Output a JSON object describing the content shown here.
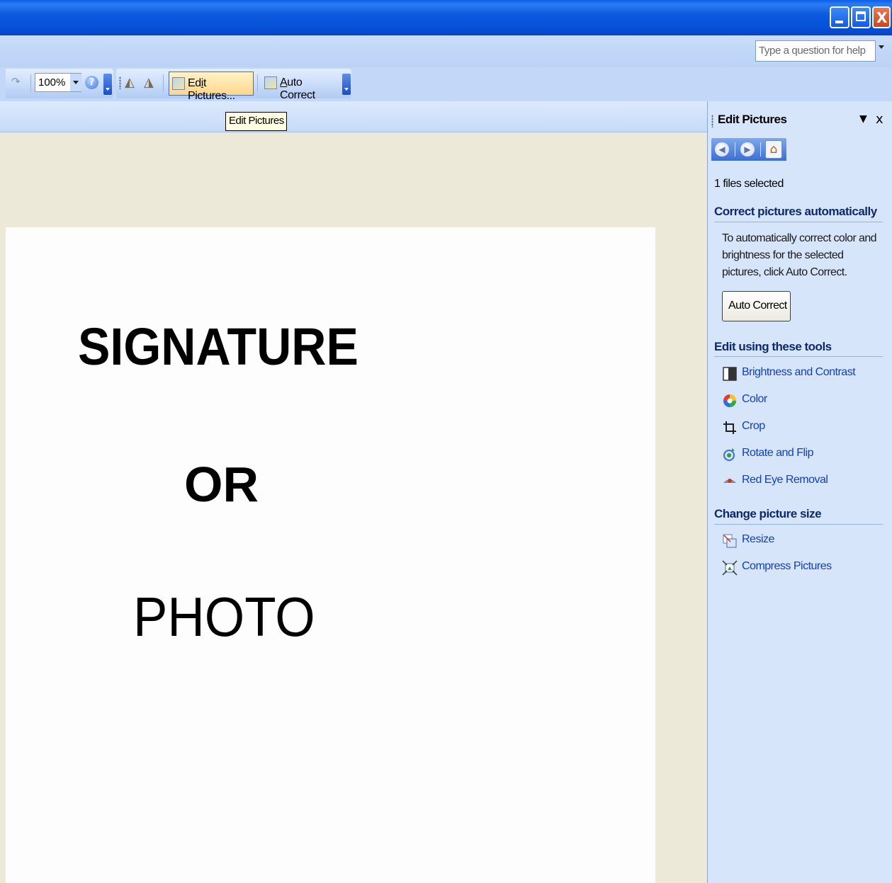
{
  "window": {
    "minimize_icon": "minimize-icon",
    "restore_icon": "restore-icon",
    "close_icon": "close-icon",
    "close_glyph": "X"
  },
  "menubar": {
    "help_placeholder": "Type a question for help"
  },
  "toolbar": {
    "zoom": "100%",
    "help_glyph": "?",
    "edit_pictures_label": "Edit Pictures...",
    "auto_correct_label": "Auto Correct",
    "edit_pictures_first": "Ed",
    "edit_pictures_ul": "i",
    "edit_pictures_rest": "t Pictures...",
    "auto_correct_ul": "A",
    "auto_correct_rest": "uto Correct"
  },
  "tooltip": "Edit Pictures",
  "document": {
    "line1": "SIGNATURE",
    "line2": "OR",
    "line3": "PHOTO"
  },
  "task_pane": {
    "title": "Edit Pictures",
    "menu_glyph": "▼",
    "close_glyph": "x",
    "files_selected": "1 files selected",
    "section_auto": "Correct pictures automatically",
    "auto_description": "To automatically correct color and brightness for the selected pictures, click Auto Correct.",
    "auto_button": "Auto Correct",
    "section_tools": "Edit using these tools",
    "tools": [
      {
        "label": "Brightness and Contrast",
        "icon": "brightness-icon"
      },
      {
        "label": "Color",
        "icon": "color-wheel-icon"
      },
      {
        "label": "Crop",
        "icon": "crop-icon"
      },
      {
        "label": "Rotate and Flip",
        "icon": "rotate-icon"
      },
      {
        "label": "Red Eye Removal",
        "icon": "red-eye-icon"
      }
    ],
    "section_size": "Change picture size",
    "size_tools": [
      {
        "label": "Resize",
        "icon": "resize-icon"
      },
      {
        "label": "Compress Pictures",
        "icon": "compress-icon"
      }
    ]
  }
}
